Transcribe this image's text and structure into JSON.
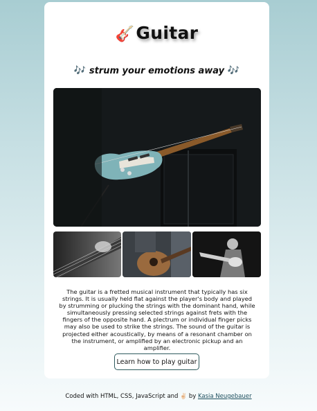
{
  "header": {
    "title_emoji": "🎸",
    "title": "Guitar",
    "tagline_note_left": "🎶",
    "tagline": "strum your emotions away",
    "tagline_note_right": "🎶"
  },
  "gallery": {
    "hero_icon": "electric-guitar-photo",
    "thumbs": [
      "guitar-neck-photo",
      "acoustic-guitar-player-photo",
      "guitarist-performing-photo"
    ]
  },
  "description": "The guitar is a fretted musical instrument that typically has six strings. It is usually held flat against the player's body and played by strumming or plucking the strings with the dominant hand, while simultaneously pressing selected strings against frets with the fingers of the opposite hand. A plectrum or individual finger picks may also be used to strike the strings. The sound of the guitar is projected either acoustically, by means of a resonant chamber on the instrument, or amplified by an electronic pickup and an amplifier.",
  "cta": {
    "label": "Learn how to play guitar"
  },
  "footer": {
    "prefix": "Coded with HTML, CSS, JavaScript and",
    "hand": "✌🏻",
    "by": "by",
    "author": "Kasia Neugebauer"
  },
  "colors": {
    "accent": "#2e5a5d",
    "link": "#1d4f5e",
    "guitar_body": "#7fb3b8"
  }
}
